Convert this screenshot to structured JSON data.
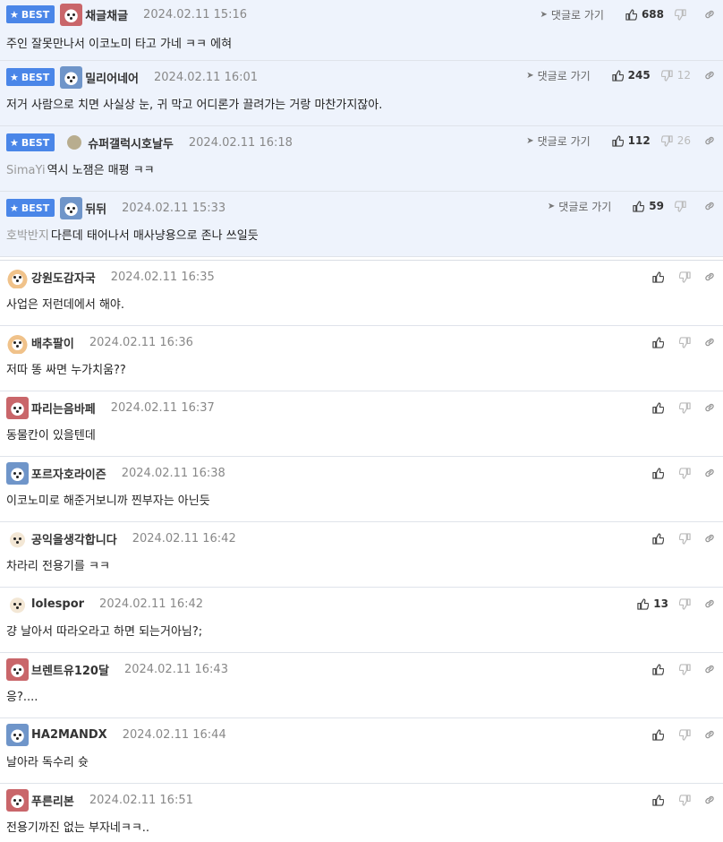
{
  "labels": {
    "best": "BEST",
    "goto": "댓글로 가기"
  },
  "best_comments": [
    {
      "avatar": "pink-dog-avatar",
      "nick": "채글채글",
      "date": "2024.02.11 15:16",
      "prefix": "",
      "text": "주인 잘못만나서 이코노미 타고 가네 ㅋㅋ 에혀",
      "up": "688",
      "down": ""
    },
    {
      "avatar": "blue-dog-avatar",
      "nick": "밀리어네어",
      "date": "2024.02.11 16:01",
      "prefix": "",
      "text": "저거 사람으로 치면 사실상 눈, 귀 막고 어디론가 끌려가는 거랑 마찬가지잖아.",
      "up": "245",
      "down": "12"
    },
    {
      "avatar": "dot-avatar",
      "nick": "슈퍼갤럭시호날두",
      "date": "2024.02.11 16:18",
      "prefix": "SimaYi",
      "text": "역시 노잼은 매평 ㅋㅋ",
      "up": "112",
      "down": "26"
    },
    {
      "avatar": "blue-dog-avatar",
      "nick": "뒤뒤",
      "date": "2024.02.11 15:33",
      "prefix": "호박반지",
      "text": "다른데 태어나서 매사냥용으로 존나 쓰일듯",
      "up": "59",
      "down": ""
    }
  ],
  "comments": [
    {
      "avatar": "fox-avatar",
      "nick": "강원도감자국",
      "date": "2024.02.11 16:35",
      "text": "사업은 저런데에서 해야.",
      "up": ""
    },
    {
      "avatar": "fox-avatar",
      "nick": "배추팔이",
      "date": "2024.02.11 16:36",
      "text": "저따 똥 싸면 누가치움??",
      "up": ""
    },
    {
      "avatar": "pink-dog-avatar",
      "nick": "파리는음바페",
      "date": "2024.02.11 16:37",
      "text": "동물칸이 있을텐데",
      "up": ""
    },
    {
      "avatar": "blue-dog-avatar",
      "nick": "포르자호라이즌",
      "date": "2024.02.11 16:38",
      "text": "이코노미로 해준거보니까 찐부자는 아닌듯",
      "up": ""
    },
    {
      "avatar": "puppy-avatar",
      "nick": "공익을생각합니다",
      "date": "2024.02.11 16:42",
      "text": "차라리 전용기를 ㅋㅋ",
      "up": ""
    },
    {
      "avatar": "puppy-avatar",
      "nick": "lolespor",
      "date": "2024.02.11 16:42",
      "text": "걍 날아서 따라오라고 하면 되는거아님?;",
      "up": "13"
    },
    {
      "avatar": "pink-dog-avatar",
      "nick": "브렌트유120달",
      "date": "2024.02.11 16:43",
      "text": "응?....",
      "up": ""
    },
    {
      "avatar": "blue-dog-avatar",
      "nick": "HA2MANDX",
      "date": "2024.02.11 16:44",
      "text": "날아라 독수리 슛",
      "up": ""
    },
    {
      "avatar": "pink-dog-avatar",
      "nick": "푸른리본",
      "date": "2024.02.11 16:51",
      "text": "전용기까진 없는 부자네ㅋㅋ..",
      "up": ""
    }
  ],
  "colors": {
    "best_bg": "#eef3fc",
    "badge": "#4a86e8",
    "divider": "#dfe3ea"
  }
}
